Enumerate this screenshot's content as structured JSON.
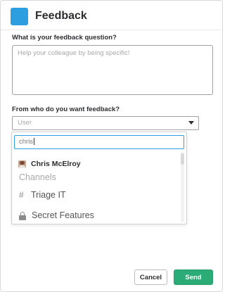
{
  "dialog": {
    "title": "Feedback",
    "icon": "app-square-icon",
    "accent_color": "#2d9ee0"
  },
  "question": {
    "label": "What is your feedback question?",
    "placeholder": "Help your colleague by being specific!",
    "value": ""
  },
  "recipient": {
    "label": "From who do you want feedback?",
    "select_placeholder": "User",
    "filter_value": "chris",
    "options": {
      "user": {
        "name": "Chris McElroy",
        "icon": "avatar"
      },
      "section_heading": "Channels",
      "channels": [
        {
          "name": "Triage IT",
          "icon": "hash-icon"
        },
        {
          "name": "Secret Features",
          "icon": "lock-icon"
        }
      ]
    }
  },
  "actions": {
    "cancel_label": "Cancel",
    "send_label": "Send",
    "send_color": "#2bac76"
  }
}
